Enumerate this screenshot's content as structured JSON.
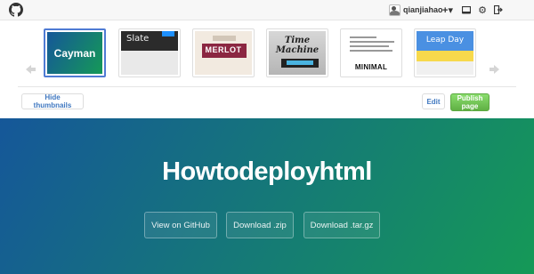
{
  "topbar": {
    "logo_icon": "github-octocat-icon",
    "username": "qianjiahao",
    "actions": [
      {
        "name": "create-new-icon",
        "glyph": "+▾"
      },
      {
        "name": "notifications-icon",
        "glyph": "▭"
      },
      {
        "name": "settings-icon",
        "glyph": "⚙"
      },
      {
        "name": "sign-out-icon",
        "glyph": "⇥"
      }
    ]
  },
  "themes": {
    "prev_icon": "chevron-left-icon",
    "next_icon": "chevron-right-icon",
    "items": [
      {
        "id": "cayman",
        "label": "Cayman",
        "selected": true
      },
      {
        "id": "slate",
        "label": "Slate",
        "selected": false
      },
      {
        "id": "merlot",
        "label": "MERLOT",
        "selected": false
      },
      {
        "id": "time-machine",
        "label": "Time Machine",
        "selected": false
      },
      {
        "id": "minimal",
        "label": "MINIMAL",
        "selected": false
      },
      {
        "id": "leap-day",
        "label": "Leap Day",
        "selected": false
      }
    ]
  },
  "toolbar": {
    "hide_thumbnails": "Hide thumbnails",
    "edit": "Edit",
    "publish": "Publish page"
  },
  "hero": {
    "title": "Howtodeployhtml",
    "buttons": [
      {
        "id": "view-on-github",
        "label": "View on GitHub"
      },
      {
        "id": "download-zip",
        "label": "Download .zip"
      },
      {
        "id": "download-targz",
        "label": "Download .tar.gz"
      }
    ]
  },
  "colors": {
    "hero_start": "#155799",
    "hero_end": "#159957",
    "publish_green": "#60b044",
    "link_blue": "#4078c0",
    "selected_border": "#4f7bd4"
  }
}
